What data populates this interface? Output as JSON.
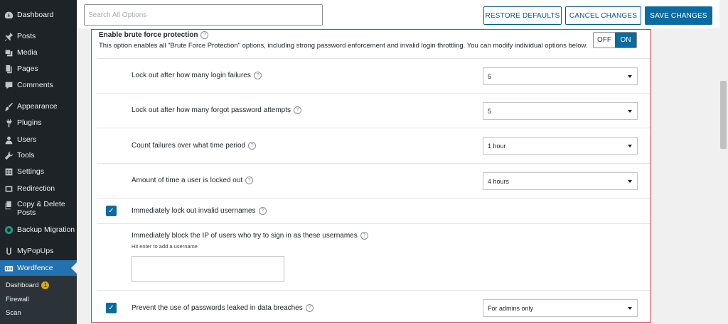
{
  "sidebar": {
    "items": [
      {
        "label": "Dashboard",
        "icon": "dashboard-icon"
      },
      {
        "label": "Posts",
        "icon": "pin-icon"
      },
      {
        "label": "Media",
        "icon": "media-icon"
      },
      {
        "label": "Pages",
        "icon": "page-icon"
      },
      {
        "label": "Comments",
        "icon": "comment-icon"
      },
      {
        "label": "Appearance",
        "icon": "brush-icon"
      },
      {
        "label": "Plugins",
        "icon": "plug-icon"
      },
      {
        "label": "Users",
        "icon": "user-icon"
      },
      {
        "label": "Tools",
        "icon": "wrench-icon"
      },
      {
        "label": "Settings",
        "icon": "settings-icon"
      },
      {
        "label": "Redirection",
        "icon": "redirect-icon"
      },
      {
        "label_line1": "Copy & Delete",
        "label_line2": "Posts",
        "icon": "copy-icon"
      },
      {
        "label": "Backup Migration",
        "icon": "backup-icon"
      },
      {
        "label": "MyPopUps",
        "icon": "popup-icon"
      },
      {
        "label": "Wordfence",
        "icon": "wordfence-icon"
      }
    ],
    "submenu": [
      {
        "label": "Dashboard",
        "badge": "1"
      },
      {
        "label": "Firewall"
      },
      {
        "label": "Scan"
      }
    ]
  },
  "topbar": {
    "search_placeholder": "Search All Options",
    "restore_label": "RESTORE DEFAULTS",
    "cancel_label": "CANCEL CHANGES",
    "save_label": "SAVE CHANGES"
  },
  "panel": {
    "title": "Enable brute force protection",
    "description": "This option enables all \"Brute Force Protection\" options, including strong password enforcement and invalid login throttling. You can modify individual options below.",
    "toggle_off": "OFF",
    "toggle_on": "ON",
    "toggle_state": "ON"
  },
  "options": {
    "login_failures": {
      "label": "Lock out after how many login failures",
      "value": "5"
    },
    "forgot_password": {
      "label": "Lock out after how many forgot password attempts",
      "value": "5"
    },
    "count_period": {
      "label": "Count failures over what time period",
      "value": "1 hour"
    },
    "lockout_time": {
      "label": "Amount of time a user is locked out",
      "value": "4 hours"
    },
    "invalid_usernames": {
      "label": "Immediately lock out invalid usernames",
      "checked": true
    },
    "block_usernames": {
      "label": "Immediately block the IP of users who try to sign in as these usernames",
      "hint": "Hit enter to add a username",
      "value": ""
    },
    "leaked_passwords": {
      "label": "Prevent the use of passwords leaked in data breaches",
      "checked": true,
      "value": "For admins only"
    }
  },
  "colors": {
    "sidebar_bg": "#1d2327",
    "active_bg": "#2271b1",
    "primary": "#0a6ba0",
    "highlight_border": "#d63638",
    "badge": "#dba617"
  }
}
